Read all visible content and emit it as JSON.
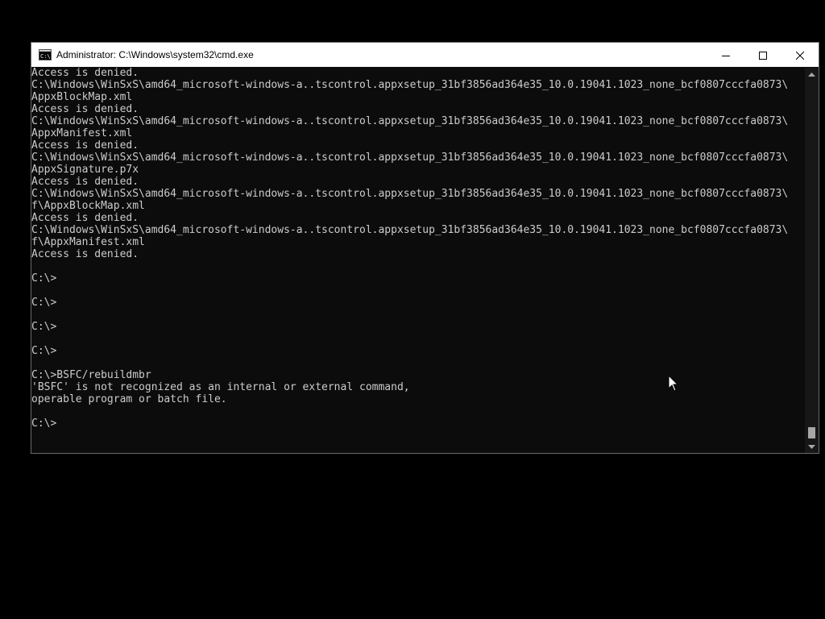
{
  "window": {
    "title": "Administrator: C:\\Windows\\system32\\cmd.exe",
    "icon": "cmd-icon"
  },
  "controls": {
    "minimize_icon": "minimize-icon",
    "maximize_icon": "maximize-icon",
    "close_icon": "close-icon"
  },
  "console": {
    "lines": [
      "Access is denied.",
      "C:\\Windows\\WinSxS\\amd64_microsoft-windows-a..tscontrol.appxsetup_31bf3856ad364e35_10.0.19041.1023_none_bcf0807cccfa0873\\",
      "AppxBlockMap.xml",
      "Access is denied.",
      "C:\\Windows\\WinSxS\\amd64_microsoft-windows-a..tscontrol.appxsetup_31bf3856ad364e35_10.0.19041.1023_none_bcf0807cccfa0873\\",
      "AppxManifest.xml",
      "Access is denied.",
      "C:\\Windows\\WinSxS\\amd64_microsoft-windows-a..tscontrol.appxsetup_31bf3856ad364e35_10.0.19041.1023_none_bcf0807cccfa0873\\",
      "AppxSignature.p7x",
      "Access is denied.",
      "C:\\Windows\\WinSxS\\amd64_microsoft-windows-a..tscontrol.appxsetup_31bf3856ad364e35_10.0.19041.1023_none_bcf0807cccfa0873\\",
      "f\\AppxBlockMap.xml",
      "Access is denied.",
      "C:\\Windows\\WinSxS\\amd64_microsoft-windows-a..tscontrol.appxsetup_31bf3856ad364e35_10.0.19041.1023_none_bcf0807cccfa0873\\",
      "f\\AppxManifest.xml",
      "Access is denied.",
      "",
      "C:\\>",
      "",
      "C:\\>",
      "",
      "C:\\>",
      "",
      "C:\\>",
      "",
      "C:\\>BSFC/rebuildmbr",
      "'BSFC' is not recognized as an internal or external command,",
      "operable program or batch file.",
      "",
      "C:\\>"
    ]
  },
  "scrollbar": {
    "up_icon": "scroll-up-arrow-icon",
    "down_icon": "scroll-down-arrow-icon"
  },
  "colors": {
    "console_bg": "#0c0c0c",
    "console_text": "#cccccc",
    "titlebar_bg": "#ffffff"
  }
}
